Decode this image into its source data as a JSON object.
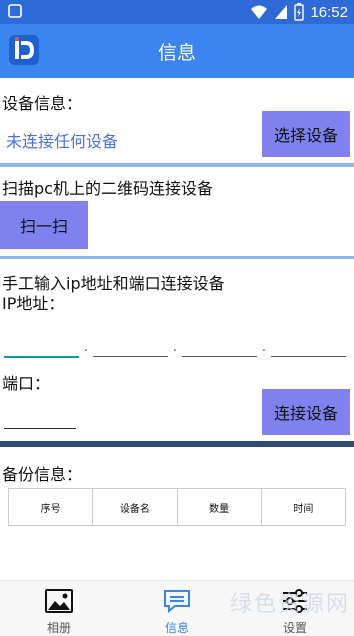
{
  "status_bar": {
    "time": "16:52",
    "icons": [
      "wifi-icon",
      "signal-icon",
      "battery-charging-icon"
    ]
  },
  "app_bar": {
    "title": "信息",
    "logo": "app-logo-icon"
  },
  "device_info": {
    "label": "设备信息：",
    "status": "未连接任何设备",
    "select_button": "选择设备"
  },
  "scan": {
    "label": "扫描pc机上的二维码连接设备",
    "button": "扫一扫"
  },
  "manual": {
    "label": "手工输入ip地址和端口连接设备",
    "ip_label": "IP地址：",
    "ip_separator": ".",
    "port_label": "端口：",
    "connect_button": "连接设备"
  },
  "backup": {
    "label": "备份信息：",
    "columns": [
      "序号",
      "设备名",
      "数量",
      "时间"
    ]
  },
  "bottom_nav": {
    "items": [
      {
        "label": "相册",
        "icon": "image-icon",
        "active": false
      },
      {
        "label": "信息",
        "icon": "message-icon",
        "active": true
      },
      {
        "label": "设置",
        "icon": "sliders-icon",
        "active": false
      }
    ]
  },
  "watermark": "绿色资源网",
  "colors": {
    "status_bar": "#2f6bd6",
    "app_bar": "#3a85ee",
    "button": "#7f82ee",
    "accent_text": "#4b72e0",
    "ip_underline_active": "#1a9a8c"
  }
}
